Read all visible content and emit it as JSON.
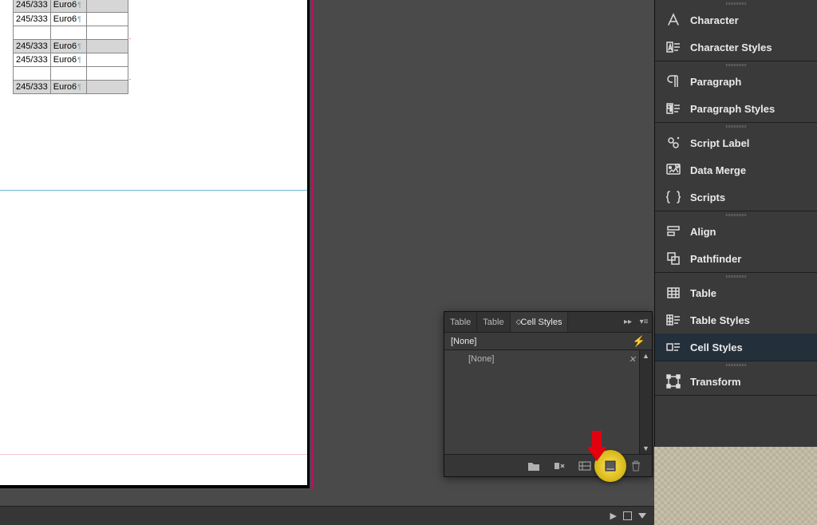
{
  "table": {
    "rows": [
      {
        "c1": "245/333",
        "c2": "Euro6",
        "shaded": true,
        "partial": true
      },
      {
        "c1": "245/333",
        "c2": "Euro6",
        "shaded": false
      },
      {
        "c1": "",
        "c2": "",
        "shaded": false,
        "blank": true
      },
      {
        "c1": "245/333",
        "c2": "Euro6",
        "shaded": true
      },
      {
        "c1": "245/333",
        "c2": "Euro6",
        "shaded": false
      },
      {
        "c1": "",
        "c2": "",
        "shaded": false,
        "blank": true
      },
      {
        "c1": "245/333",
        "c2": "Euro6",
        "shaded": true
      }
    ]
  },
  "float_panel": {
    "tabs": [
      "Table",
      "Table",
      "Cell Styles"
    ],
    "active_tab_index": 2,
    "current": "[None]",
    "list_item": "[None]"
  },
  "dock": {
    "groups": [
      {
        "items": [
          {
            "icon": "character",
            "label": "Character"
          },
          {
            "icon": "character-styles",
            "label": "Character Styles"
          }
        ]
      },
      {
        "items": [
          {
            "icon": "paragraph",
            "label": "Paragraph"
          },
          {
            "icon": "paragraph-styles",
            "label": "Paragraph Styles"
          }
        ]
      },
      {
        "items": [
          {
            "icon": "script-label",
            "label": "Script Label"
          },
          {
            "icon": "data-merge",
            "label": "Data Merge"
          },
          {
            "icon": "scripts",
            "label": "Scripts"
          }
        ]
      },
      {
        "items": [
          {
            "icon": "align",
            "label": "Align"
          },
          {
            "icon": "pathfinder",
            "label": "Pathfinder"
          }
        ]
      },
      {
        "items": [
          {
            "icon": "table",
            "label": "Table"
          },
          {
            "icon": "table-styles",
            "label": "Table Styles"
          },
          {
            "icon": "cell-styles",
            "label": "Cell Styles",
            "active": true
          }
        ]
      },
      {
        "items": [
          {
            "icon": "transform",
            "label": "Transform"
          }
        ]
      }
    ]
  }
}
